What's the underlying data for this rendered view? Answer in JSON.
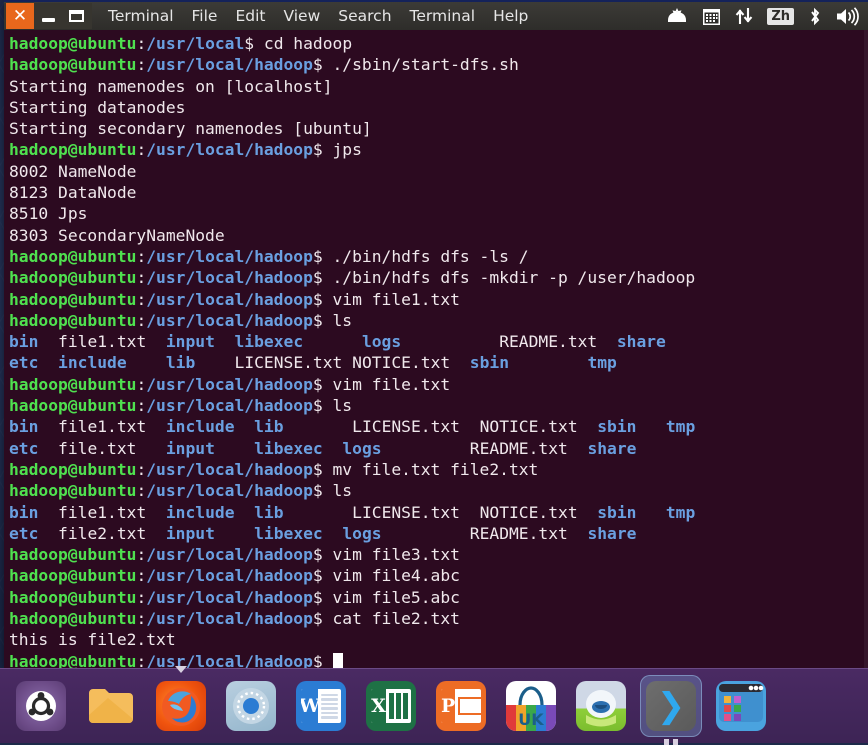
{
  "window": {
    "title": "Terminal",
    "controls": {
      "close": "✕",
      "minimize": "—",
      "maximize": "▢"
    },
    "menu": [
      "File",
      "Edit",
      "View",
      "Search",
      "Terminal",
      "Help"
    ],
    "tray": [
      "update-icon",
      "calendar-icon",
      "network-icon",
      "Zh",
      "bluetooth-icon",
      "volume-icon"
    ]
  },
  "theme": {
    "terminal_bg": "#2c0a20",
    "prompt_user_color": "#4fe14f",
    "prompt_path_color": "#6a9fe0",
    "text_color": "#f0e8ec",
    "titlebar_bg": "#37352f",
    "close_button_bg": "#e8671c",
    "dock_bg": "#4a2a63"
  },
  "terminal": {
    "prompt_user": "hadoop@ubuntu",
    "prompt_sep": ":",
    "prompt_sigil": "$",
    "cursor": "block",
    "lines": [
      {
        "type": "prompt",
        "path": "/usr/local",
        "cmd": " cd hadoop"
      },
      {
        "type": "prompt",
        "path": "/usr/local/hadoop",
        "cmd": " ./sbin/start-dfs.sh"
      },
      {
        "type": "output",
        "text": "Starting namenodes on [localhost]"
      },
      {
        "type": "output",
        "text": "Starting datanodes"
      },
      {
        "type": "output",
        "text": "Starting secondary namenodes [ubuntu]"
      },
      {
        "type": "prompt",
        "path": "/usr/local/hadoop",
        "cmd": " jps"
      },
      {
        "type": "output",
        "text": "8002 NameNode"
      },
      {
        "type": "output",
        "text": "8123 DataNode"
      },
      {
        "type": "output",
        "text": "8510 Jps"
      },
      {
        "type": "output",
        "text": "8303 SecondaryNameNode"
      },
      {
        "type": "prompt",
        "path": "/usr/local/hadoop",
        "cmd": " ./bin/hdfs dfs -ls /"
      },
      {
        "type": "prompt",
        "path": "/usr/local/hadoop",
        "cmd": " ./bin/hdfs dfs -mkdir -p /user/hadoop"
      },
      {
        "type": "prompt",
        "path": "/usr/local/hadoop",
        "cmd": " vim file1.txt"
      },
      {
        "type": "prompt",
        "path": "/usr/local/hadoop",
        "cmd": " ls"
      },
      {
        "type": "ls",
        "cells": [
          {
            "t": "bin",
            "k": "dir"
          },
          {
            "t": "  ",
            "k": "gap"
          },
          {
            "t": "file1.txt",
            "k": "file"
          },
          {
            "t": "  ",
            "k": "gap"
          },
          {
            "t": "input",
            "k": "dir"
          },
          {
            "t": "  ",
            "k": "gap"
          },
          {
            "t": "libexec",
            "k": "dir"
          },
          {
            "t": "      ",
            "k": "gap"
          },
          {
            "t": "logs",
            "k": "dir"
          },
          {
            "t": "          ",
            "k": "gap"
          },
          {
            "t": "README.txt",
            "k": "file"
          },
          {
            "t": "  ",
            "k": "gap"
          },
          {
            "t": "share",
            "k": "dir"
          }
        ]
      },
      {
        "type": "ls",
        "cells": [
          {
            "t": "etc",
            "k": "dir"
          },
          {
            "t": "  ",
            "k": "gap"
          },
          {
            "t": "include",
            "k": "dir"
          },
          {
            "t": "    ",
            "k": "gap"
          },
          {
            "t": "lib",
            "k": "dir"
          },
          {
            "t": "    ",
            "k": "gap"
          },
          {
            "t": "LICENSE.txt",
            "k": "file"
          },
          {
            "t": " ",
            "k": "gap"
          },
          {
            "t": "NOTICE.txt",
            "k": "file"
          },
          {
            "t": "  ",
            "k": "gap"
          },
          {
            "t": "sbin",
            "k": "dir"
          },
          {
            "t": "        ",
            "k": "gap"
          },
          {
            "t": "tmp",
            "k": "dir"
          }
        ]
      },
      {
        "type": "prompt",
        "path": "/usr/local/hadoop",
        "cmd": " vim file.txt"
      },
      {
        "type": "prompt",
        "path": "/usr/local/hadoop",
        "cmd": " ls"
      },
      {
        "type": "ls",
        "cells": [
          {
            "t": "bin",
            "k": "dir"
          },
          {
            "t": "  ",
            "k": "gap"
          },
          {
            "t": "file1.txt",
            "k": "file"
          },
          {
            "t": "  ",
            "k": "gap"
          },
          {
            "t": "include",
            "k": "dir"
          },
          {
            "t": "  ",
            "k": "gap"
          },
          {
            "t": "lib",
            "k": "dir"
          },
          {
            "t": "       ",
            "k": "gap"
          },
          {
            "t": "LICENSE.txt",
            "k": "file"
          },
          {
            "t": "  ",
            "k": "gap"
          },
          {
            "t": "NOTICE.txt",
            "k": "file"
          },
          {
            "t": "  ",
            "k": "gap"
          },
          {
            "t": "sbin",
            "k": "dir"
          },
          {
            "t": "   ",
            "k": "gap"
          },
          {
            "t": "tmp",
            "k": "dir"
          }
        ]
      },
      {
        "type": "ls",
        "cells": [
          {
            "t": "etc",
            "k": "dir"
          },
          {
            "t": "  ",
            "k": "gap"
          },
          {
            "t": "file.txt",
            "k": "file"
          },
          {
            "t": "   ",
            "k": "gap"
          },
          {
            "t": "input",
            "k": "dir"
          },
          {
            "t": "    ",
            "k": "gap"
          },
          {
            "t": "libexec",
            "k": "dir"
          },
          {
            "t": "  ",
            "k": "gap"
          },
          {
            "t": "logs",
            "k": "dir"
          },
          {
            "t": "         ",
            "k": "gap"
          },
          {
            "t": "README.txt",
            "k": "file"
          },
          {
            "t": "  ",
            "k": "gap"
          },
          {
            "t": "share",
            "k": "dir"
          }
        ]
      },
      {
        "type": "prompt",
        "path": "/usr/local/hadoop",
        "cmd": " mv file.txt file2.txt"
      },
      {
        "type": "prompt",
        "path": "/usr/local/hadoop",
        "cmd": " ls"
      },
      {
        "type": "ls",
        "cells": [
          {
            "t": "bin",
            "k": "dir"
          },
          {
            "t": "  ",
            "k": "gap"
          },
          {
            "t": "file1.txt",
            "k": "file"
          },
          {
            "t": "  ",
            "k": "gap"
          },
          {
            "t": "include",
            "k": "dir"
          },
          {
            "t": "  ",
            "k": "gap"
          },
          {
            "t": "lib",
            "k": "dir"
          },
          {
            "t": "       ",
            "k": "gap"
          },
          {
            "t": "LICENSE.txt",
            "k": "file"
          },
          {
            "t": "  ",
            "k": "gap"
          },
          {
            "t": "NOTICE.txt",
            "k": "file"
          },
          {
            "t": "  ",
            "k": "gap"
          },
          {
            "t": "sbin",
            "k": "dir"
          },
          {
            "t": "   ",
            "k": "gap"
          },
          {
            "t": "tmp",
            "k": "dir"
          }
        ]
      },
      {
        "type": "ls",
        "cells": [
          {
            "t": "etc",
            "k": "dir"
          },
          {
            "t": "  ",
            "k": "gap"
          },
          {
            "t": "file2.txt",
            "k": "file"
          },
          {
            "t": "  ",
            "k": "gap"
          },
          {
            "t": "input",
            "k": "dir"
          },
          {
            "t": "    ",
            "k": "gap"
          },
          {
            "t": "libexec",
            "k": "dir"
          },
          {
            "t": "  ",
            "k": "gap"
          },
          {
            "t": "logs",
            "k": "dir"
          },
          {
            "t": "         ",
            "k": "gap"
          },
          {
            "t": "README.txt",
            "k": "file"
          },
          {
            "t": "  ",
            "k": "gap"
          },
          {
            "t": "share",
            "k": "dir"
          }
        ]
      },
      {
        "type": "prompt",
        "path": "/usr/local/hadoop",
        "cmd": " vim file3.txt"
      },
      {
        "type": "prompt",
        "path": "/usr/local/hadoop",
        "cmd": " vim file4.abc"
      },
      {
        "type": "prompt",
        "path": "/usr/local/hadoop",
        "cmd": " vim file5.abc"
      },
      {
        "type": "prompt",
        "path": "/usr/local/hadoop",
        "cmd": " cat file2.txt"
      },
      {
        "type": "output",
        "text": "this is file2.txt"
      },
      {
        "type": "prompt",
        "path": "/usr/local/hadoop",
        "cmd": " ",
        "cursor": true
      }
    ]
  },
  "dock": {
    "items": [
      {
        "name": "ubuntu-logo",
        "label": "Ubuntu",
        "state": ""
      },
      {
        "name": "files",
        "label": "Files",
        "state": ""
      },
      {
        "name": "firefox",
        "label": "Firefox",
        "state": "active"
      },
      {
        "name": "chromium",
        "label": "Chromium",
        "state": ""
      },
      {
        "name": "word",
        "label": "Word",
        "state": ""
      },
      {
        "name": "excel",
        "label": "Excel",
        "state": ""
      },
      {
        "name": "powerpoint",
        "label": "PowerPoint",
        "state": ""
      },
      {
        "name": "ubuntu-kylin-software-center",
        "label": "UK",
        "state": ""
      },
      {
        "name": "youker-assistant",
        "label": "Youker",
        "state": ""
      },
      {
        "name": "terminal",
        "label": "Terminal",
        "state": "running"
      },
      {
        "name": "app-window",
        "label": "Applications",
        "state": ""
      }
    ]
  }
}
